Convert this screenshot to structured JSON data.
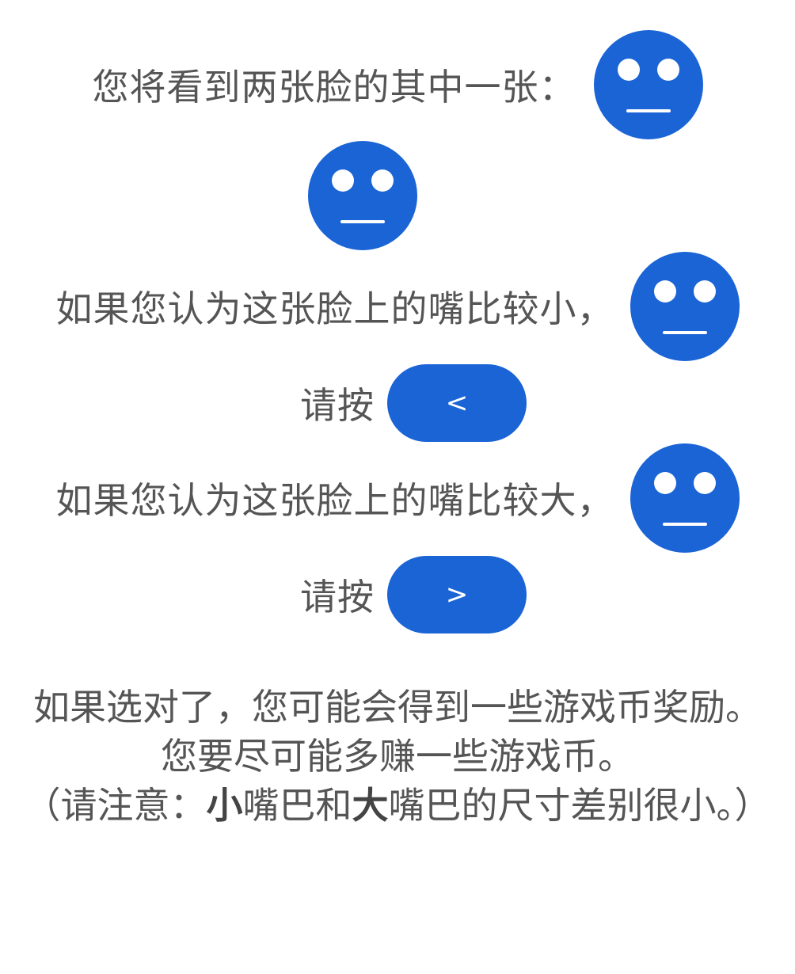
{
  "intro": {
    "text": "您将看到两张脸的其中一张："
  },
  "small_mouth": {
    "condition": "如果您认为这张脸上的嘴比较小，",
    "press_label": "请按",
    "key_label": "<"
  },
  "large_mouth": {
    "condition": "如果您认为这张脸上的嘴比较大，",
    "press_label": "请按",
    "key_label": ">"
  },
  "reward": {
    "line1": "如果选对了，您可能会得到一些游戏币奖励。",
    "line2": "您要尽可能多赚一些游戏币。"
  },
  "note": {
    "prefix": "（请注意：",
    "small": "小",
    "mid1": "嘴巴和",
    "big": "大",
    "suffix": "嘴巴的尺寸差别很小。）"
  },
  "colors": {
    "accent": "#1a64d6",
    "text": "#555555",
    "background": "#ffffff"
  },
  "icons": {
    "face": "neutral-face-icon"
  }
}
